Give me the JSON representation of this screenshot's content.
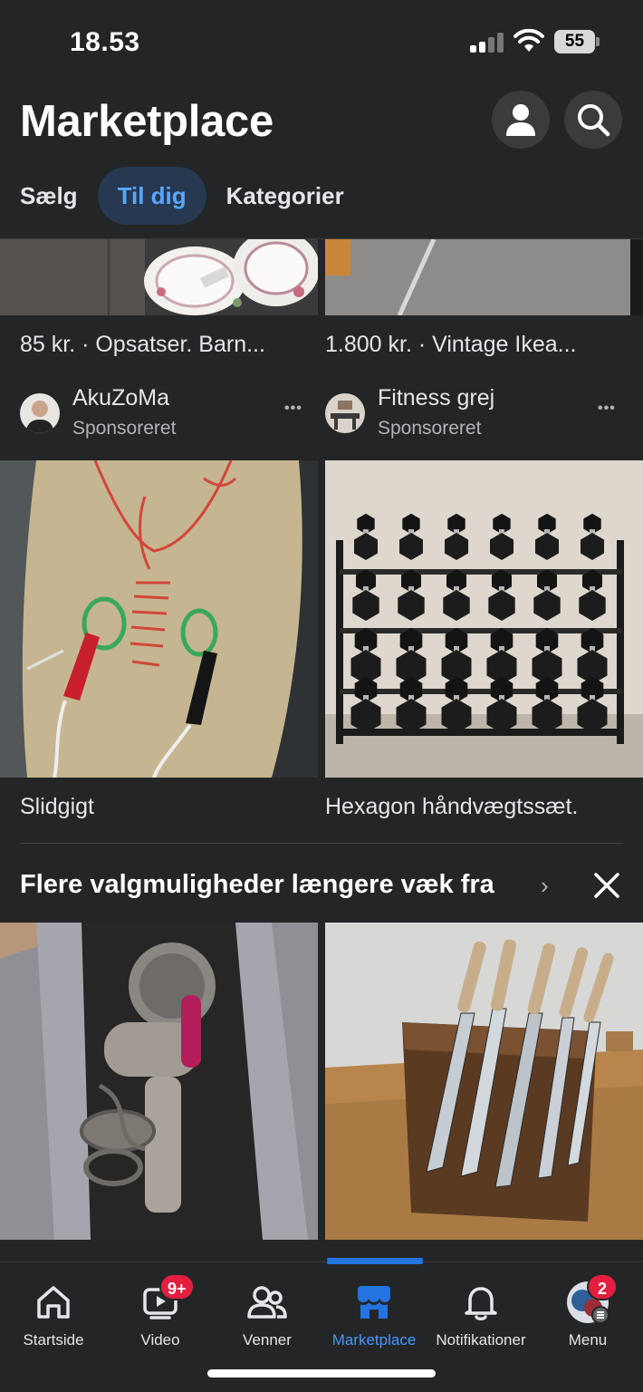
{
  "status_bar": {
    "time": "18.53",
    "battery": "55"
  },
  "header": {
    "title": "Marketplace",
    "profile_icon": "person-icon",
    "search_icon": "search-icon"
  },
  "tabs": [
    {
      "label": "Sælg",
      "active": false
    },
    {
      "label": "Til dig",
      "active": true
    },
    {
      "label": "Kategorier",
      "active": false
    }
  ],
  "listings_top": [
    {
      "title": "85 kr. · Opsatser. Barn...",
      "seller": "AkuZoMa",
      "sponsored": "Sponsoreret",
      "more": "•••"
    },
    {
      "title": "1.800 kr. · Vintage Ikea...",
      "seller": "Fitness grej",
      "sponsored": "Sponsoreret",
      "more": "•••"
    }
  ],
  "listings_mid": [
    {
      "title": "Slidgigt"
    },
    {
      "title": "Hexagon håndvægtssæt."
    }
  ],
  "section": {
    "title": "Flere valgmuligheder længere væk fra",
    "chevron": "›"
  },
  "bottom_nav": [
    {
      "label": "Startside",
      "icon": "home-icon"
    },
    {
      "label": "Video",
      "icon": "video-icon",
      "badge": "9+"
    },
    {
      "label": "Venner",
      "icon": "friends-icon"
    },
    {
      "label": "Marketplace",
      "icon": "marketplace-icon",
      "active": true
    },
    {
      "label": "Notifikationer",
      "icon": "bell-icon"
    },
    {
      "label": "Menu",
      "icon": "avatar-icon",
      "badge": "2"
    }
  ],
  "colors": {
    "background": "#242526",
    "accent": "#2374e1",
    "active_tab_bg": "#263951",
    "badge": "#e41e3f"
  }
}
